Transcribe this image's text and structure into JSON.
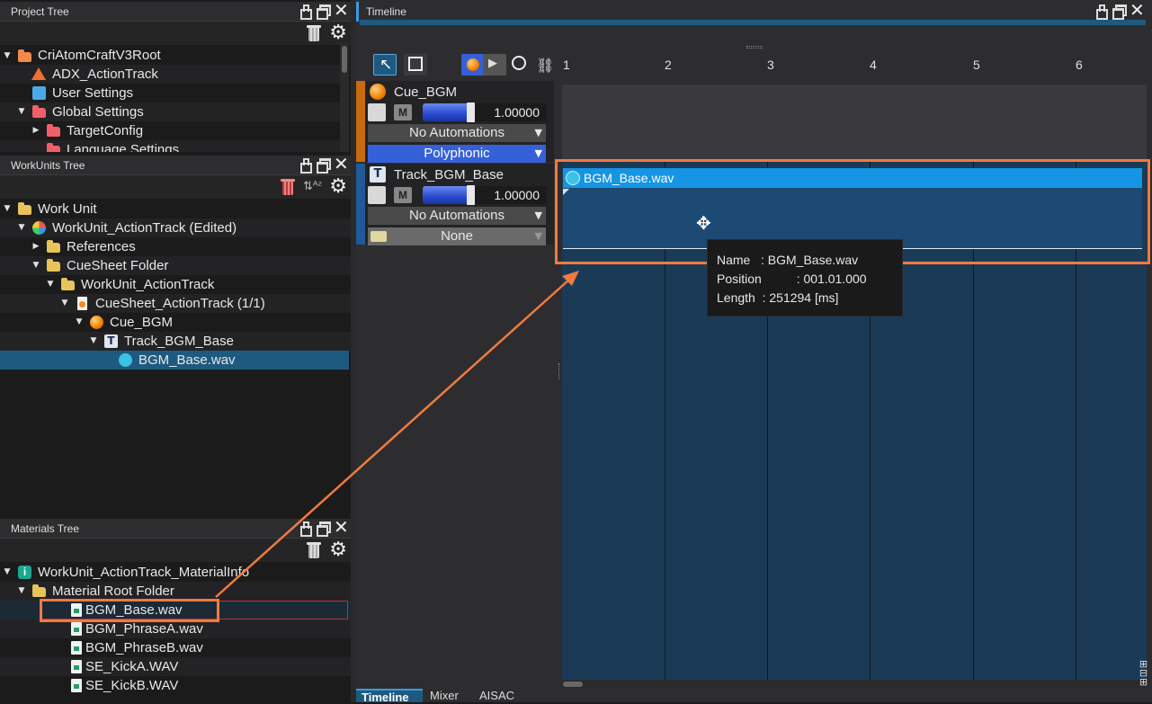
{
  "project_tree": {
    "title": "Project Tree",
    "items": [
      {
        "label": "CriAtomCraftV3Root",
        "icon": "folder-orange-icon"
      },
      {
        "label": "ADX_ActionTrack",
        "icon": "adx-icon"
      },
      {
        "label": "User Settings",
        "icon": "user-settings-icon"
      },
      {
        "label": "Global Settings",
        "icon": "folder-red-icon"
      },
      {
        "label": "TargetConfig",
        "icon": "folder-red-icon"
      },
      {
        "label": "Language Settings",
        "icon": "folder-red-icon"
      }
    ]
  },
  "workunits_tree": {
    "title": "WorkUnits Tree",
    "items": [
      {
        "label": "Work Unit",
        "icon": "folder-icon"
      },
      {
        "label": "WorkUnit_ActionTrack (Edited)",
        "icon": "workunit-icon"
      },
      {
        "label": "References",
        "icon": "folder-icon"
      },
      {
        "label": "CueSheet Folder",
        "icon": "folder-icon"
      },
      {
        "label": "WorkUnit_ActionTrack",
        "icon": "folder-icon"
      },
      {
        "label": "CueSheet_ActionTrack (1/1)",
        "icon": "cuesheet-icon"
      },
      {
        "label": "Cue_BGM",
        "icon": "cue-icon"
      },
      {
        "label": "Track_BGM_Base",
        "icon": "track-icon"
      },
      {
        "label": "BGM_Base.wav",
        "icon": "waveform-icon"
      }
    ]
  },
  "materials_tree": {
    "title": "Materials Tree",
    "items": [
      {
        "label": "WorkUnit_ActionTrack_MaterialInfo",
        "icon": "materialinfo-icon"
      },
      {
        "label": "Material Root Folder",
        "icon": "folder-icon"
      },
      {
        "label": "BGM_Base.wav",
        "icon": "wav-file-icon"
      },
      {
        "label": "BGM_PhraseA.wav",
        "icon": "wav-file-icon"
      },
      {
        "label": "BGM_PhraseB.wav",
        "icon": "wav-file-icon"
      },
      {
        "label": "SE_KickA.WAV",
        "icon": "wav-file-icon"
      },
      {
        "label": "SE_KickB.WAV",
        "icon": "wav-file-icon"
      }
    ]
  },
  "timeline": {
    "title": "Timeline",
    "ruler": [
      "1",
      "2",
      "3",
      "4",
      "5",
      "6"
    ],
    "cue": {
      "name": "Cue_BGM",
      "volume": "1.00000",
      "automation": "No Automations",
      "mode": "Polyphonic",
      "mute_label": "M"
    },
    "track": {
      "name": "Track_BGM_Base",
      "volume": "1.00000",
      "automation": "No Automations",
      "selector": "None",
      "mute_label": "M",
      "icon_letter": "T"
    },
    "clip": {
      "name": "BGM_Base.wav"
    },
    "tooltip": {
      "name_line": "Name   : BGM_Base.wav",
      "position_line": "Position          : 001.01.000",
      "length_line": "Length  : 251294 [ms]"
    }
  },
  "bottom_tabs": [
    "Timeline",
    "Mixer",
    "AISAC"
  ],
  "colors": {
    "accent_orange": "#f07830",
    "selection_blue": "#1e5a80",
    "clip_header": "#1595e3",
    "clip_body": "#1d4a73"
  }
}
